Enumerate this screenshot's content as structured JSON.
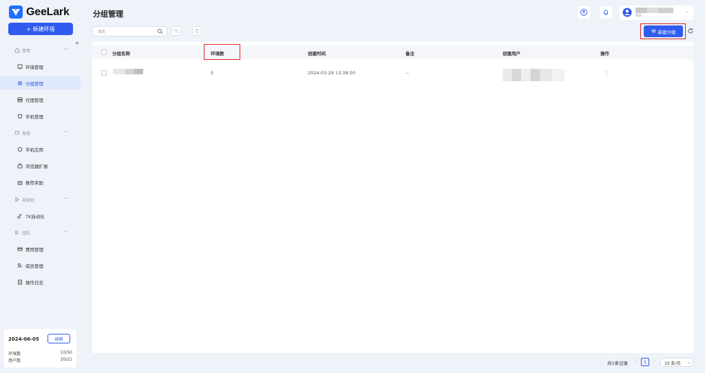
{
  "app": {
    "name": "GeeLark"
  },
  "sidebar": {
    "new_env_label": "+ 新建环境",
    "groups": [
      {
        "label": "常用",
        "icon": "home-icon"
      },
      {
        "label": "发现",
        "icon": "discover-icon"
      },
      {
        "label": "自动化",
        "icon": "automation-icon"
      },
      {
        "label": "团队",
        "icon": "team-icon"
      }
    ],
    "items": [
      {
        "label": "环境管理",
        "icon": "environment-icon"
      },
      {
        "label": "分组管理",
        "icon": "group-list-icon",
        "active": true
      },
      {
        "label": "代理管理",
        "icon": "proxy-icon"
      },
      {
        "label": "手机管理",
        "icon": "phone-icon"
      },
      {
        "label": "手机应用",
        "icon": "app-icon"
      },
      {
        "label": "浏览器扩展",
        "icon": "extension-icon"
      },
      {
        "label": "推荐奖励",
        "icon": "gift-icon"
      },
      {
        "label": "TK自动化",
        "icon": "tiktok-icon"
      },
      {
        "label": "费用管理",
        "icon": "billing-icon"
      },
      {
        "label": "成员管理",
        "icon": "members-icon"
      },
      {
        "label": "操作日志",
        "icon": "log-icon"
      }
    ],
    "info": {
      "date": "2024-06-05",
      "renew_label": "续期",
      "env_label": "环境数",
      "env_value": "10/50",
      "user_label": "用户数",
      "user_value": "20/21"
    }
  },
  "header": {
    "title": "分组管理",
    "user_role": "成员"
  },
  "toolbar": {
    "search_placeholder": "搜索",
    "new_group_label": "新建分组"
  },
  "table": {
    "columns": [
      "分组名称",
      "环境数",
      "创建时间",
      "备注",
      "创建用户",
      "操作"
    ],
    "rows": [
      {
        "name": "",
        "env_count": "5",
        "created": "2024-03-29 13:38:50",
        "note": "--",
        "user": "",
        "action": "⋮"
      }
    ]
  },
  "pagination": {
    "total": "共1条记录",
    "current": "1",
    "page_size": "10 条/页"
  },
  "colors": {
    "accent": "#2f5bef",
    "highlight": "#e02424",
    "background": "#eef2f9"
  }
}
